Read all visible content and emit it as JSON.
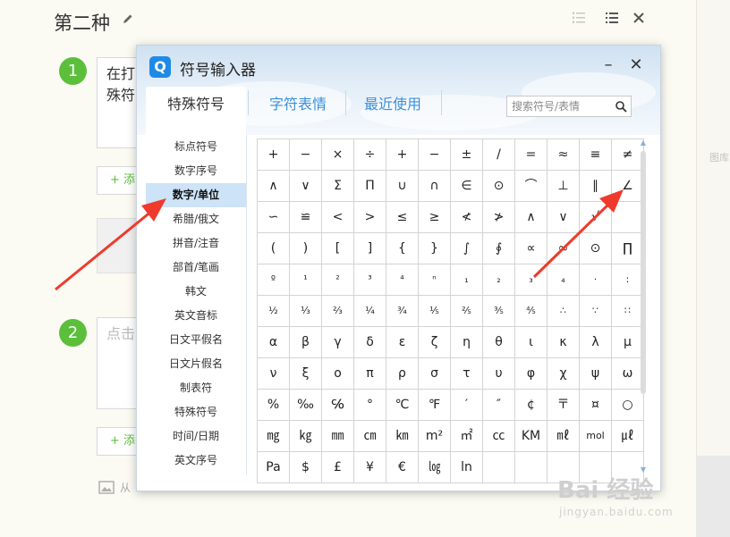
{
  "page": {
    "title": "第二种",
    "step1_number": "1",
    "step1_text": "在打\n殊符",
    "step2_number": "2",
    "step2_placeholder": "点击",
    "add_label_1": "+ 添",
    "add_label_2": "+ 添",
    "bottom_hint": "从",
    "right_panel_text": "图库"
  },
  "dialog": {
    "logo_letter": "Q",
    "title": "符号输入器",
    "minimize_label": "–",
    "close_label": "✕",
    "tabs": [
      {
        "label": "特殊符号",
        "active": true
      },
      {
        "label": "字符表情",
        "active": false
      },
      {
        "label": "最近使用",
        "active": false
      }
    ],
    "search_placeholder": "搜索符号/表情",
    "categories": [
      {
        "label": "标点符号",
        "active": false
      },
      {
        "label": "数字序号",
        "active": false
      },
      {
        "label": "数字/单位",
        "active": true
      },
      {
        "label": "希腊/俄文",
        "active": false
      },
      {
        "label": "拼音/注音",
        "active": false
      },
      {
        "label": "部首/笔画",
        "active": false
      },
      {
        "label": "韩文",
        "active": false
      },
      {
        "label": "英文音标",
        "active": false
      },
      {
        "label": "日文平假名",
        "active": false
      },
      {
        "label": "日文片假名",
        "active": false
      },
      {
        "label": "制表符",
        "active": false
      },
      {
        "label": "特殊符号",
        "active": false
      },
      {
        "label": "时间/日期",
        "active": false
      },
      {
        "label": "英文序号",
        "active": false
      }
    ],
    "symbols": [
      [
        "+",
        "−",
        "×",
        "÷",
        "+",
        "−",
        "±",
        "/",
        "=",
        "≈",
        "≡",
        "≠"
      ],
      [
        "∧",
        "∨",
        "Σ",
        "Π",
        "∪",
        "∩",
        "∈",
        "⊙",
        "⌒",
        "⊥",
        "∥",
        "∠"
      ],
      [
        "∽",
        "≌",
        "<",
        ">",
        "≤",
        "≥",
        "≮",
        "≯",
        "∧",
        "∨",
        "√",
        ""
      ],
      [
        "(",
        ")",
        "[",
        "]",
        "{",
        "}",
        "∫",
        "∮",
        "∝",
        "∞",
        "⊙",
        "∏"
      ],
      [
        "º",
        "¹",
        "²",
        "³",
        "⁴",
        "ⁿ",
        "₁",
        "₂",
        "₃",
        "₄",
        "·",
        ":"
      ],
      [
        "½",
        "⅓",
        "⅔",
        "¼",
        "¾",
        "⅕",
        "⅖",
        "⅗",
        "⅘",
        "∴",
        "∵",
        "∷"
      ],
      [
        "α",
        "β",
        "γ",
        "δ",
        "ε",
        "ζ",
        "η",
        "θ",
        "ι",
        "κ",
        "λ",
        "μ"
      ],
      [
        "ν",
        "ξ",
        "ο",
        "π",
        "ρ",
        "σ",
        "τ",
        "υ",
        "φ",
        "χ",
        "ψ",
        "ω"
      ],
      [
        "%",
        "‰",
        "℅",
        "°",
        "℃",
        "℉",
        "′",
        "″",
        "¢",
        "〒",
        "¤",
        "○"
      ],
      [
        "㎎",
        "㎏",
        "㎜",
        "㎝",
        "㎞",
        "m²",
        "㎡",
        "㏄",
        "KM",
        "㎖",
        "mol",
        "㎕"
      ],
      [
        "Pa",
        "$",
        "£",
        "¥",
        "€",
        "㏒",
        "ln",
        "",
        "",
        "",
        "",
        ""
      ]
    ]
  },
  "watermark": {
    "main": "Bai 经验",
    "sub": "jingyan.baidu.com"
  },
  "colors": {
    "accent_green": "#5cbf3c",
    "accent_blue": "#3a8fd9",
    "arrow_red": "#ee3b2c"
  }
}
